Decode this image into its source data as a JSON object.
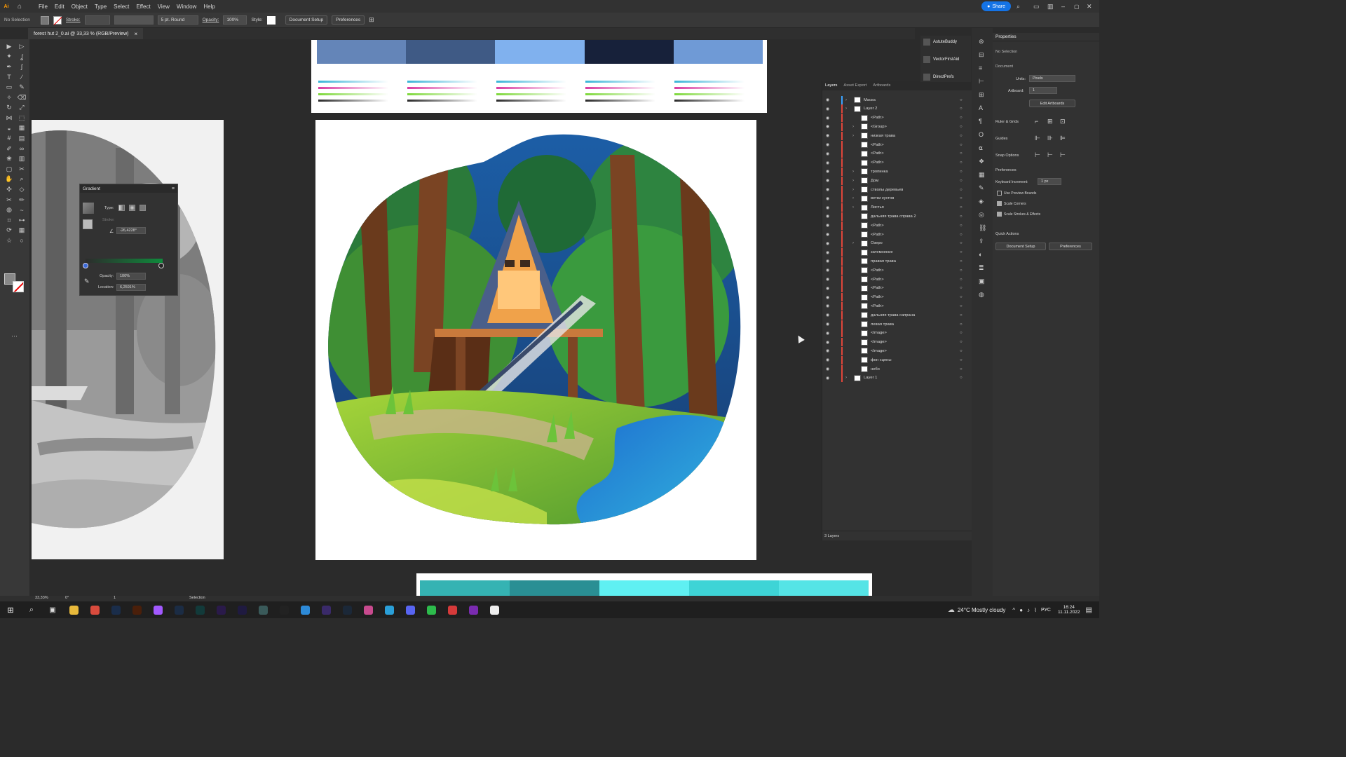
{
  "menubar": {
    "app_logo": "Ai",
    "menus": [
      "File",
      "Edit",
      "Object",
      "Type",
      "Select",
      "Effect",
      "View",
      "Window",
      "Help"
    ],
    "share_label": "Share"
  },
  "control_bar": {
    "selection_label": "No Selection",
    "stroke_label": "Stroke:",
    "brush_label": "5 pt. Round",
    "opacity_label": "Opacity:",
    "opacity_value": "100%",
    "style_label": "Style:",
    "document_setup": "Document Setup",
    "preferences": "Preferences"
  },
  "document_tab": {
    "title": "forest hut 2_0.ai @ 33,33 % (RGB/Preview)",
    "close_glyph": "×"
  },
  "swatches": {
    "colors": [
      "#6485b8",
      "#3f5a85",
      "#80b1ee",
      "#17213a",
      "#6f9ad6"
    ],
    "bottom_colors": [
      "#35b3b3",
      "#2a8f94",
      "#5ff0f2",
      "#3ed4d6",
      "#55e4e6"
    ]
  },
  "gradient_panel": {
    "title": "Gradient",
    "type_label": "Type:",
    "stroke_label": "Stroke:",
    "angle_value": "-26,4228°",
    "opacity_label": "Opacity:",
    "opacity_value": "100%",
    "location_label": "Location:",
    "location_value": "6,2591%"
  },
  "plugin_panel": {
    "items": [
      "AstuteBuddy",
      "VectorFirstAid",
      "DirectPrefs"
    ]
  },
  "layers_panel": {
    "tabs": [
      "Layers",
      "Asset Export",
      "Artboards"
    ],
    "rows": [
      {
        "name": "Маска",
        "indent": 0,
        "expand": true
      },
      {
        "name": "Layer 2",
        "indent": 0,
        "expand": true
      },
      {
        "name": "<Path>",
        "indent": 1,
        "expand": false
      },
      {
        "name": "<Group>",
        "indent": 1,
        "expand": true
      },
      {
        "name": "низкая трава",
        "indent": 1,
        "expand": true
      },
      {
        "name": "<Path>",
        "indent": 1,
        "expand": false
      },
      {
        "name": "<Path>",
        "indent": 1,
        "expand": false
      },
      {
        "name": "<Path>",
        "indent": 1,
        "expand": false
      },
      {
        "name": "тропинка",
        "indent": 1,
        "expand": true
      },
      {
        "name": "Дом",
        "indent": 1,
        "expand": true
      },
      {
        "name": "стволы деревьев",
        "indent": 1,
        "expand": true
      },
      {
        "name": "ветки кустов",
        "indent": 1,
        "expand": true
      },
      {
        "name": "Листья",
        "indent": 1,
        "expand": true
      },
      {
        "name": "дальняя трава справа 2",
        "indent": 1,
        "expand": false
      },
      {
        "name": "<Path>",
        "indent": 1,
        "expand": false
      },
      {
        "name": "<Path>",
        "indent": 1,
        "expand": false
      },
      {
        "name": "Озеро",
        "indent": 1,
        "expand": true
      },
      {
        "name": "затемнение",
        "indent": 1,
        "expand": false
      },
      {
        "name": "правая трава",
        "indent": 1,
        "expand": false
      },
      {
        "name": "<Path>",
        "indent": 1,
        "expand": false
      },
      {
        "name": "<Path>",
        "indent": 1,
        "expand": false
      },
      {
        "name": "<Path>",
        "indent": 1,
        "expand": false
      },
      {
        "name": "<Path>",
        "indent": 1,
        "expand": false
      },
      {
        "name": "<Path>",
        "indent": 1,
        "expand": false
      },
      {
        "name": "дальняя трава сапрана",
        "indent": 1,
        "expand": false
      },
      {
        "name": "левая трава",
        "indent": 1,
        "expand": false
      },
      {
        "name": "<Image>",
        "indent": 1,
        "expand": false
      },
      {
        "name": "<Image>",
        "indent": 1,
        "expand": false
      },
      {
        "name": "<Image>",
        "indent": 1,
        "expand": false
      },
      {
        "name": "фон сцены",
        "indent": 1,
        "expand": false
      },
      {
        "name": "небо",
        "indent": 1,
        "expand": false
      },
      {
        "name": "Layer 1",
        "indent": 0,
        "expand": true
      }
    ],
    "footer_count": "3 Layers"
  },
  "properties_panel": {
    "title": "Properties",
    "no_selection": "No Selection",
    "document_label": "Document",
    "units_label": "Units:",
    "units_value": "Pixels",
    "artboard_label": "Artboard:",
    "artboard_value": "1",
    "edit_artboards": "Edit Artboards",
    "rulers_grids": "Ruler & Grids",
    "guides": "Guides",
    "snap_options": "Snap Options",
    "preferences_label": "Preferences",
    "keyboard_increment_label": "Keyboard Increment:",
    "keyboard_increment_value": "1 px",
    "use_preview_bounds": "Use Preview Bounds",
    "scale_corners": "Scale Corners",
    "scale_strokes": "Scale Strokes & Effects",
    "quick_actions": "Quick Actions",
    "document_setup": "Document Setup",
    "preferences_btn": "Preferences"
  },
  "status_bar": {
    "zoom": "33,33%",
    "rotation": "0°",
    "artboard": "1",
    "tool": "Selection"
  },
  "taskbar": {
    "weather": "24°C  Mostly cloudy",
    "lang": "РУС",
    "time": "16:24",
    "date": "11.11.2022",
    "apps": [
      {
        "icon": "explorer-icon",
        "color": "#e8b93b"
      },
      {
        "icon": "chrome-icon",
        "color": "#d94b3d"
      },
      {
        "icon": "photoshop-icon",
        "color": "#1a2d4a"
      },
      {
        "icon": "illustrator-icon",
        "color": "#4a1f0a"
      },
      {
        "icon": "figma-icon",
        "color": "#a259ff"
      },
      {
        "icon": "lightroom-icon",
        "color": "#1b2c44"
      },
      {
        "icon": "audition-icon",
        "color": "#123a3a"
      },
      {
        "icon": "premiere-icon",
        "color": "#2a1a4a"
      },
      {
        "icon": "aftereffects-icon",
        "color": "#1f1a40"
      },
      {
        "icon": "app-icon",
        "color": "#3a5a5a"
      },
      {
        "icon": "obs-icon",
        "color": "#222222"
      },
      {
        "icon": "maps-icon",
        "color": "#2d8ad8"
      },
      {
        "icon": "music-icon",
        "color": "#3a2a6a"
      },
      {
        "icon": "steam-icon",
        "color": "#1b2838"
      },
      {
        "icon": "itunes-icon",
        "color": "#c84a8e"
      },
      {
        "icon": "telegram-icon",
        "color": "#2a9fd8"
      },
      {
        "icon": "discord-icon",
        "color": "#5865f2"
      },
      {
        "icon": "line-icon",
        "color": "#2dbb4c"
      },
      {
        "icon": "app-red-icon",
        "color": "#d63a3a"
      },
      {
        "icon": "onenote-icon",
        "color": "#7a2bb0"
      },
      {
        "icon": "notion-icon",
        "color": "#eeeeee"
      }
    ]
  }
}
